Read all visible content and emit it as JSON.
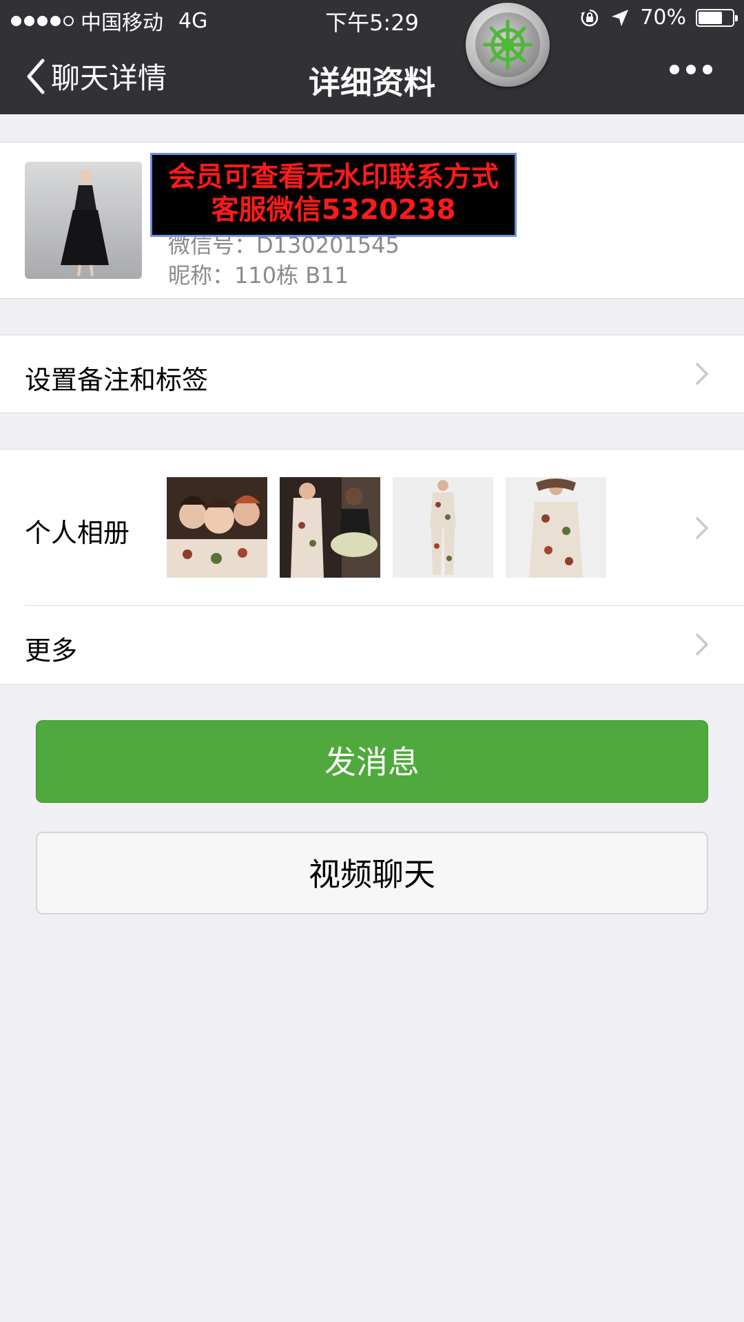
{
  "status_bar": {
    "carrier": "中国移动",
    "network": "4G",
    "time": "下午5:29",
    "battery": "70%",
    "battery_level": 0.7,
    "signal_bars_filled": 4,
    "signal_bars_total": 5
  },
  "nav": {
    "back_label": "聊天详情",
    "title": "详细资料"
  },
  "profile": {
    "name": "",
    "wechat_id": "微信号：D130201545",
    "nickname": "昵称：110栋 B11",
    "watermark_line1": "会员可查看无水印联系方式",
    "watermark_line2": "客服微信5320238"
  },
  "rows": {
    "remarks_label": "设置备注和标签",
    "album_label": "个人相册",
    "more_label": "更多"
  },
  "buttons": {
    "send_message": "发消息",
    "video_chat": "视频聊天"
  },
  "colors": {
    "header_bg": "#323236",
    "page_bg": "#efeff4",
    "send_button": "#4fa93c",
    "watermark_text": "#ff1a1a"
  }
}
